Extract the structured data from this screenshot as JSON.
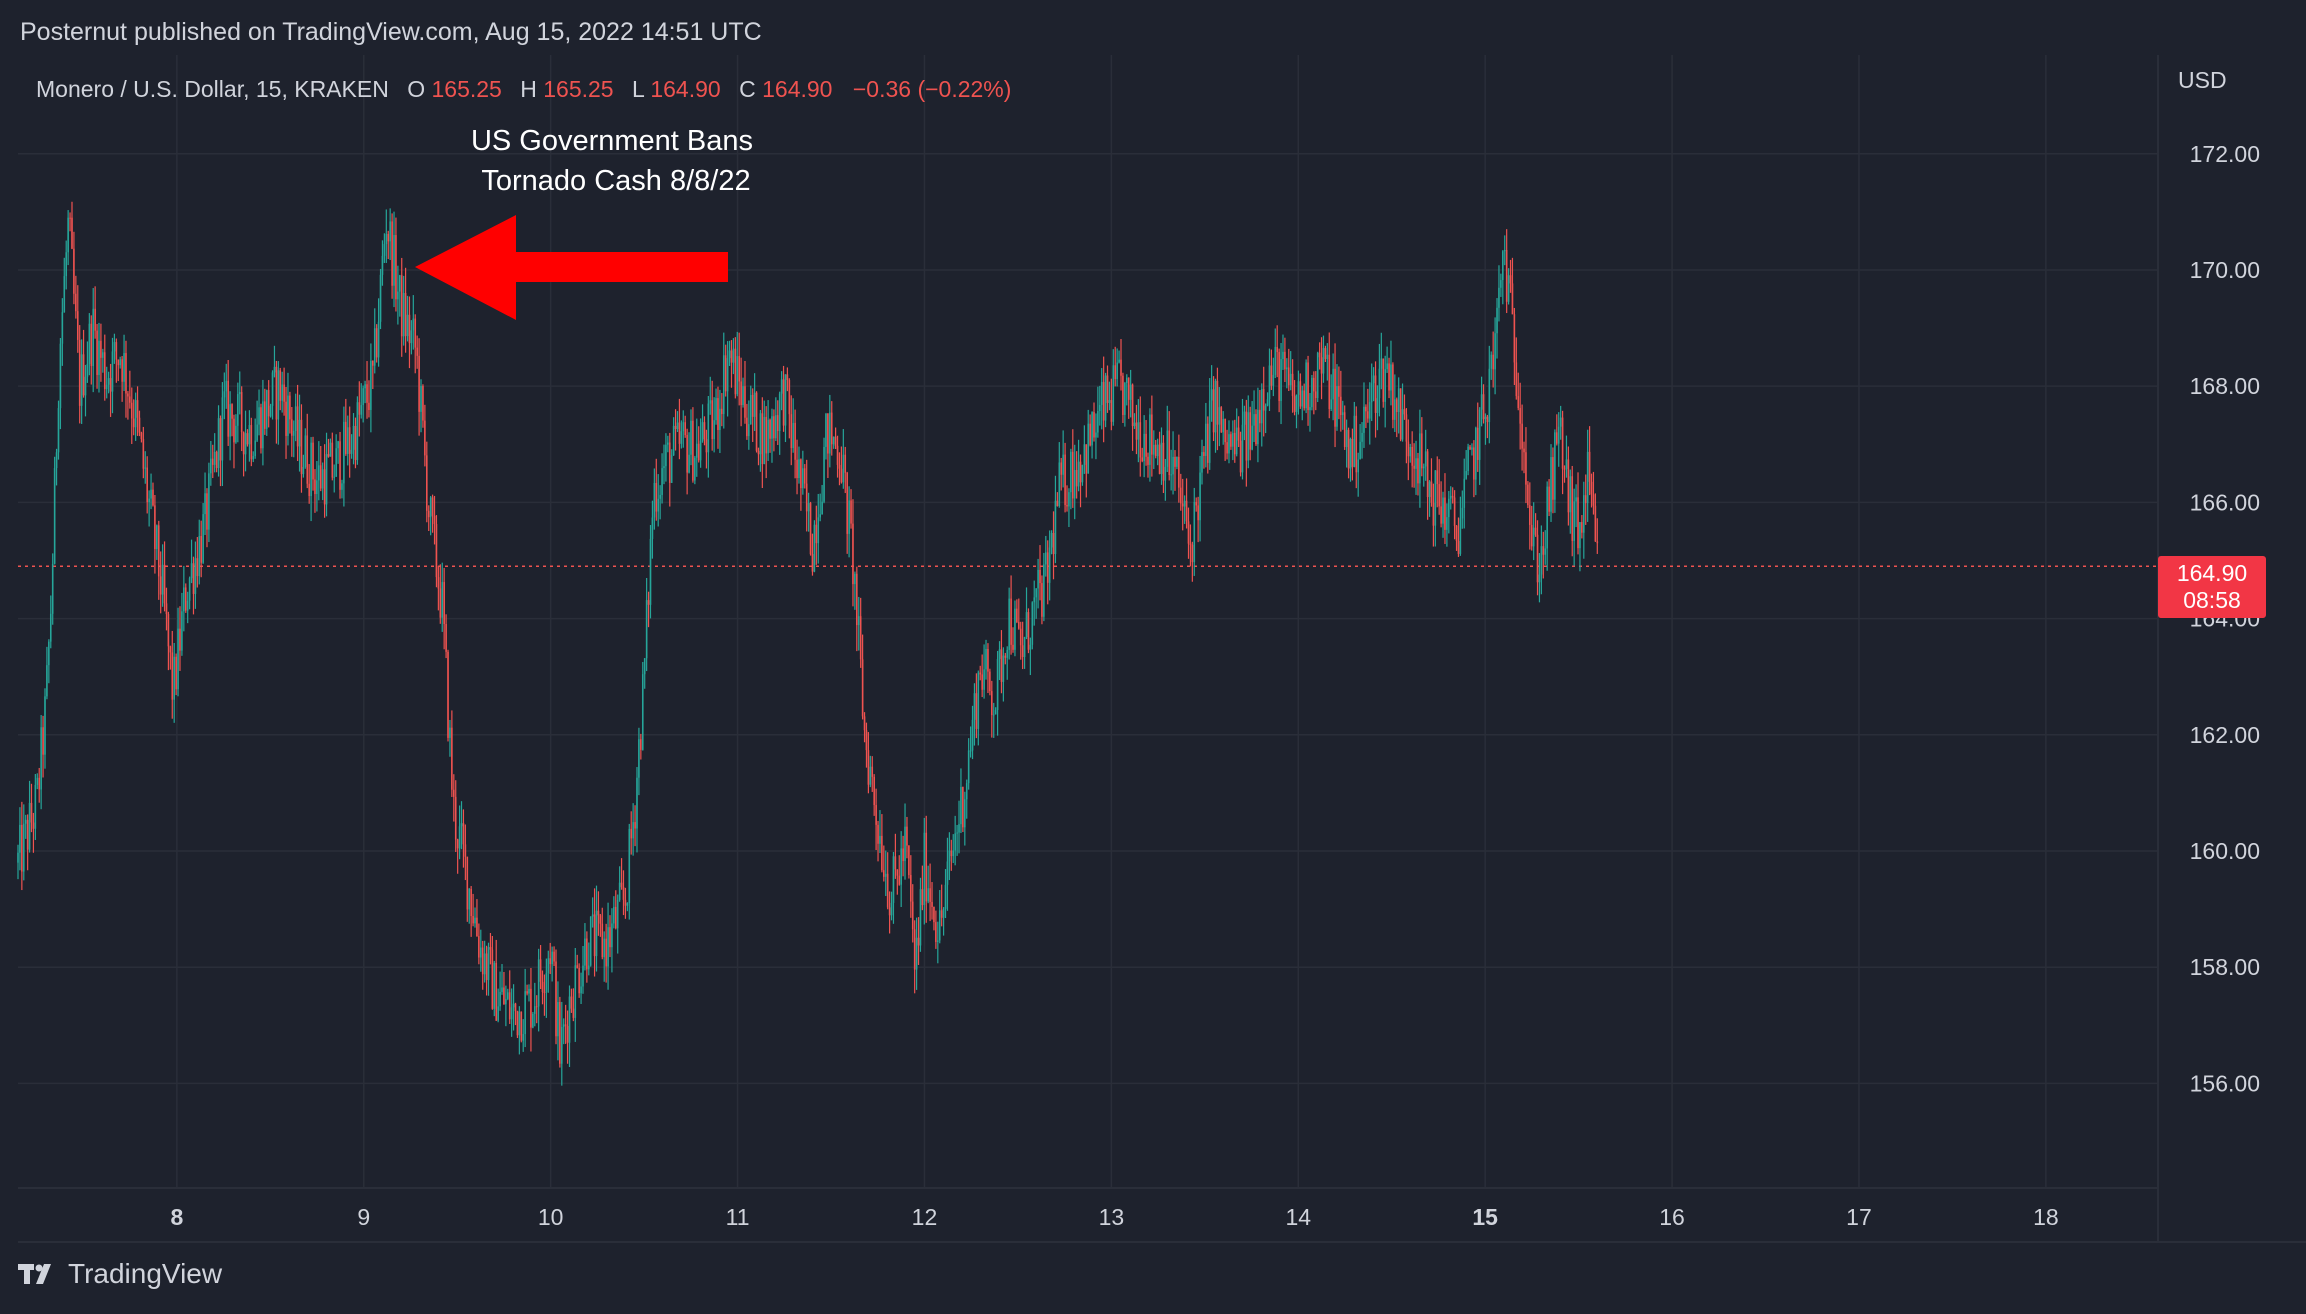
{
  "header": {
    "published": "Posternut published on TradingView.com, Aug 15, 2022 14:51 UTC"
  },
  "legend": {
    "symbol": "Monero / U.S. Dollar, 15, KRAKEN",
    "o_label": "O",
    "o_value": "165.25",
    "h_label": "H",
    "h_value": "165.25",
    "l_label": "L",
    "l_value": "164.90",
    "c_label": "C",
    "c_value": "164.90",
    "change": "−0.36 (−0.22%)"
  },
  "annotation": {
    "line1": "US Government Bans",
    "line2": "Tornado Cash 8/8/22"
  },
  "price_axis": {
    "currency": "USD"
  },
  "price_tag": {
    "price": "164.90",
    "countdown": "08:58"
  },
  "footer": {
    "brand": "TradingView"
  },
  "colors": {
    "background": "#1e222d",
    "grid": "#2a2e39",
    "text": "#d1d4dc",
    "up": "#26a69a",
    "down": "#ef5350",
    "arrow": "#ff0000",
    "price_tag": "#f23645"
  },
  "chart_data": {
    "type": "candlestick",
    "title": "Monero / U.S. Dollar, 15, KRAKEN",
    "y_ticks": [
      "156.00",
      "158.00",
      "160.00",
      "162.00",
      "164.00",
      "166.00",
      "168.00",
      "170.00",
      "172.00"
    ],
    "x_ticks": [
      "8",
      "9",
      "10",
      "11",
      "12",
      "13",
      "14",
      "15",
      "16",
      "17",
      "18"
    ],
    "x_ticks_bold": [
      "8",
      "15"
    ],
    "ylim": [
      154.2,
      173.7
    ],
    "xlim": [
      7.15,
      18.6
    ],
    "last_price": 164.9,
    "grid": true,
    "price_path": [
      [
        7.15,
        159.8
      ],
      [
        7.25,
        160.8
      ],
      [
        7.3,
        162.5
      ],
      [
        7.33,
        164.5
      ],
      [
        7.37,
        168.5
      ],
      [
        7.42,
        170.8
      ],
      [
        7.48,
        168.0
      ],
      [
        7.55,
        169.0
      ],
      [
        7.62,
        168.2
      ],
      [
        7.7,
        168.6
      ],
      [
        7.78,
        167.4
      ],
      [
        7.85,
        166.0
      ],
      [
        7.92,
        164.5
      ],
      [
        7.98,
        162.7
      ],
      [
        8.05,
        164.5
      ],
      [
        8.15,
        165.6
      ],
      [
        8.25,
        167.6
      ],
      [
        8.4,
        167.2
      ],
      [
        8.55,
        168.0
      ],
      [
        8.65,
        167.0
      ],
      [
        8.75,
        166.4
      ],
      [
        8.85,
        166.6
      ],
      [
        8.95,
        167.2
      ],
      [
        9.05,
        168.1
      ],
      [
        9.12,
        170.9
      ],
      [
        9.2,
        169.3
      ],
      [
        9.28,
        168.6
      ],
      [
        9.35,
        165.8
      ],
      [
        9.42,
        164.2
      ],
      [
        9.48,
        160.7
      ],
      [
        9.55,
        159.6
      ],
      [
        9.62,
        158.4
      ],
      [
        9.7,
        157.6
      ],
      [
        9.8,
        157.2
      ],
      [
        9.9,
        157.4
      ],
      [
        10.0,
        158.4
      ],
      [
        10.05,
        156.5
      ],
      [
        10.1,
        157.4
      ],
      [
        10.2,
        158.5
      ],
      [
        10.3,
        158.4
      ],
      [
        10.4,
        159.2
      ],
      [
        10.45,
        160.8
      ],
      [
        10.5,
        163.0
      ],
      [
        10.55,
        166.2
      ],
      [
        10.62,
        166.7
      ],
      [
        10.7,
        167.0
      ],
      [
        10.78,
        166.9
      ],
      [
        10.88,
        167.4
      ],
      [
        10.95,
        168.6
      ],
      [
        11.05,
        167.6
      ],
      [
        11.15,
        167.1
      ],
      [
        11.25,
        167.9
      ],
      [
        11.32,
        166.6
      ],
      [
        11.4,
        165.3
      ],
      [
        11.48,
        167.2
      ],
      [
        11.55,
        166.9
      ],
      [
        11.62,
        164.9
      ],
      [
        11.68,
        162.0
      ],
      [
        11.75,
        160.5
      ],
      [
        11.82,
        159.2
      ],
      [
        11.9,
        160.1
      ],
      [
        11.95,
        157.9
      ],
      [
        12.0,
        159.8
      ],
      [
        12.08,
        158.6
      ],
      [
        12.15,
        160.0
      ],
      [
        12.22,
        161.2
      ],
      [
        12.3,
        163.2
      ],
      [
        12.38,
        162.6
      ],
      [
        12.45,
        164.1
      ],
      [
        12.52,
        163.4
      ],
      [
        12.58,
        164.1
      ],
      [
        12.65,
        164.6
      ],
      [
        12.72,
        166.2
      ],
      [
        12.8,
        166.6
      ],
      [
        12.88,
        167.0
      ],
      [
        12.95,
        167.6
      ],
      [
        13.05,
        168.0
      ],
      [
        13.12,
        167.4
      ],
      [
        13.2,
        167.1
      ],
      [
        13.28,
        166.9
      ],
      [
        13.35,
        166.4
      ],
      [
        13.42,
        165.2
      ],
      [
        13.5,
        166.8
      ],
      [
        13.55,
        167.8
      ],
      [
        13.6,
        167.0
      ],
      [
        13.68,
        166.9
      ],
      [
        13.75,
        167.2
      ],
      [
        13.82,
        168.1
      ],
      [
        13.9,
        168.3
      ],
      [
        13.98,
        167.7
      ],
      [
        14.05,
        168.0
      ],
      [
        14.12,
        168.4
      ],
      [
        14.2,
        167.8
      ],
      [
        14.28,
        166.8
      ],
      [
        14.35,
        167.3
      ],
      [
        14.42,
        168.1
      ],
      [
        14.48,
        168.3
      ],
      [
        14.55,
        167.4
      ],
      [
        14.62,
        167.0
      ],
      [
        14.7,
        166.2
      ],
      [
        14.78,
        165.9
      ],
      [
        14.85,
        165.5
      ],
      [
        14.92,
        166.6
      ],
      [
        15.0,
        167.6
      ],
      [
        15.05,
        168.6
      ],
      [
        15.1,
        170.4
      ],
      [
        15.15,
        168.8
      ],
      [
        15.2,
        167.4
      ],
      [
        15.25,
        165.2
      ],
      [
        15.3,
        165.0
      ],
      [
        15.35,
        166.2
      ],
      [
        15.4,
        167.2
      ],
      [
        15.45,
        166.0
      ],
      [
        15.5,
        165.4
      ],
      [
        15.55,
        166.4
      ],
      [
        15.6,
        164.9
      ]
    ]
  }
}
